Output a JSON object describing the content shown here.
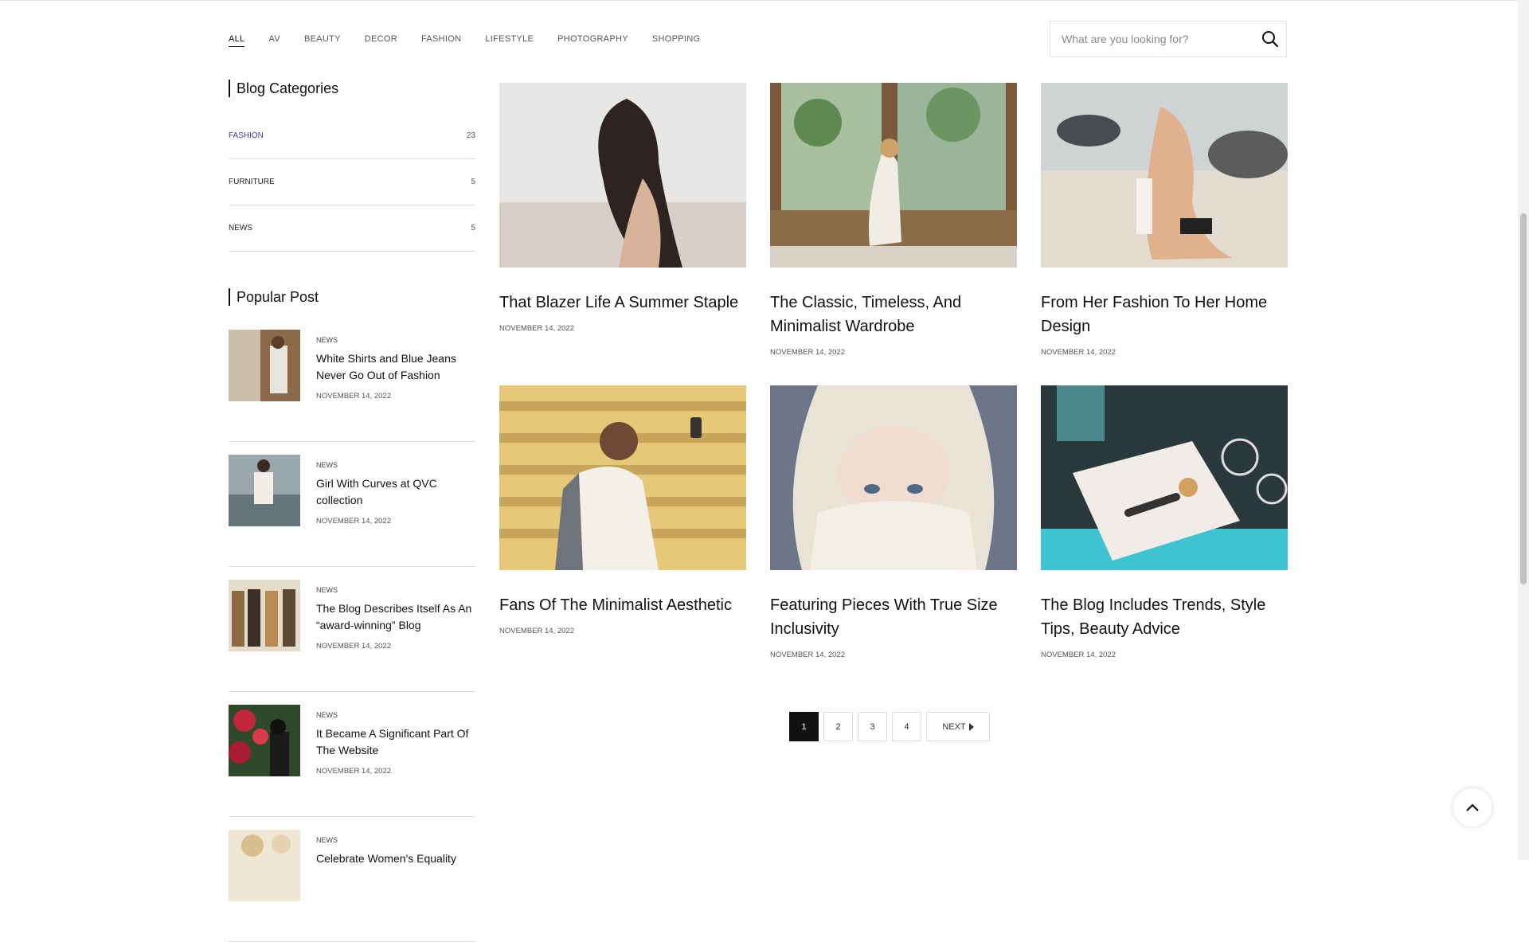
{
  "filters": [
    "ALL",
    "AV",
    "BEAUTY",
    "DECOR",
    "FASHION",
    "LIFESTYLE",
    "PHOTOGRAPHY",
    "SHOPPING"
  ],
  "search": {
    "placeholder": "What are you looking for?"
  },
  "sidebar": {
    "categories_title": "Blog Categories",
    "categories": [
      {
        "name": "FASHION",
        "count": "23"
      },
      {
        "name": "FURNITURE",
        "count": "5"
      },
      {
        "name": "NEWS",
        "count": "5"
      }
    ],
    "popular_title": "Popular Post",
    "popular": [
      {
        "tag": "NEWS",
        "title": "White Shirts and Blue Jeans Never Go Out of Fashion",
        "date": "NOVEMBER 14, 2022"
      },
      {
        "tag": "NEWS",
        "title": "Girl With Curves at QVC collection",
        "date": "NOVEMBER 14, 2022"
      },
      {
        "tag": "NEWS",
        "title": "The Blog Describes Itself As An “award-winning” Blog",
        "date": "NOVEMBER 14, 2022"
      },
      {
        "tag": "NEWS",
        "title": "It Became A Significant Part Of The Website",
        "date": "NOVEMBER 14, 2022"
      },
      {
        "tag": "NEWS",
        "title": "Celebrate Women's Equality",
        "date": ""
      }
    ]
  },
  "posts": [
    {
      "title": "That Blazer Life A Summer Staple",
      "date": "NOVEMBER 14, 2022"
    },
    {
      "title": "The Classic, Timeless, And Minimalist Wardrobe",
      "date": "NOVEMBER 14, 2022"
    },
    {
      "title": "From Her Fashion To Her Home Design",
      "date": "NOVEMBER 14, 2022"
    },
    {
      "title": "Fans Of The Minimalist Aesthetic",
      "date": "NOVEMBER 14, 2022"
    },
    {
      "title": "Featuring Pieces With True Size Inclusivity",
      "date": "NOVEMBER 14, 2022"
    },
    {
      "title": "The Blog Includes Trends, Style Tips, Beauty Advice",
      "date": "NOVEMBER 14, 2022"
    }
  ],
  "pagination": {
    "pages": [
      "1",
      "2",
      "3",
      "4"
    ],
    "next": "NEXT"
  },
  "colors": {
    "accent": "#4a3c8c",
    "active_page": "#111111"
  },
  "icons": {
    "search": "search-icon",
    "next": "caret-right-icon",
    "back_to_top": "chevron-up-icon"
  }
}
